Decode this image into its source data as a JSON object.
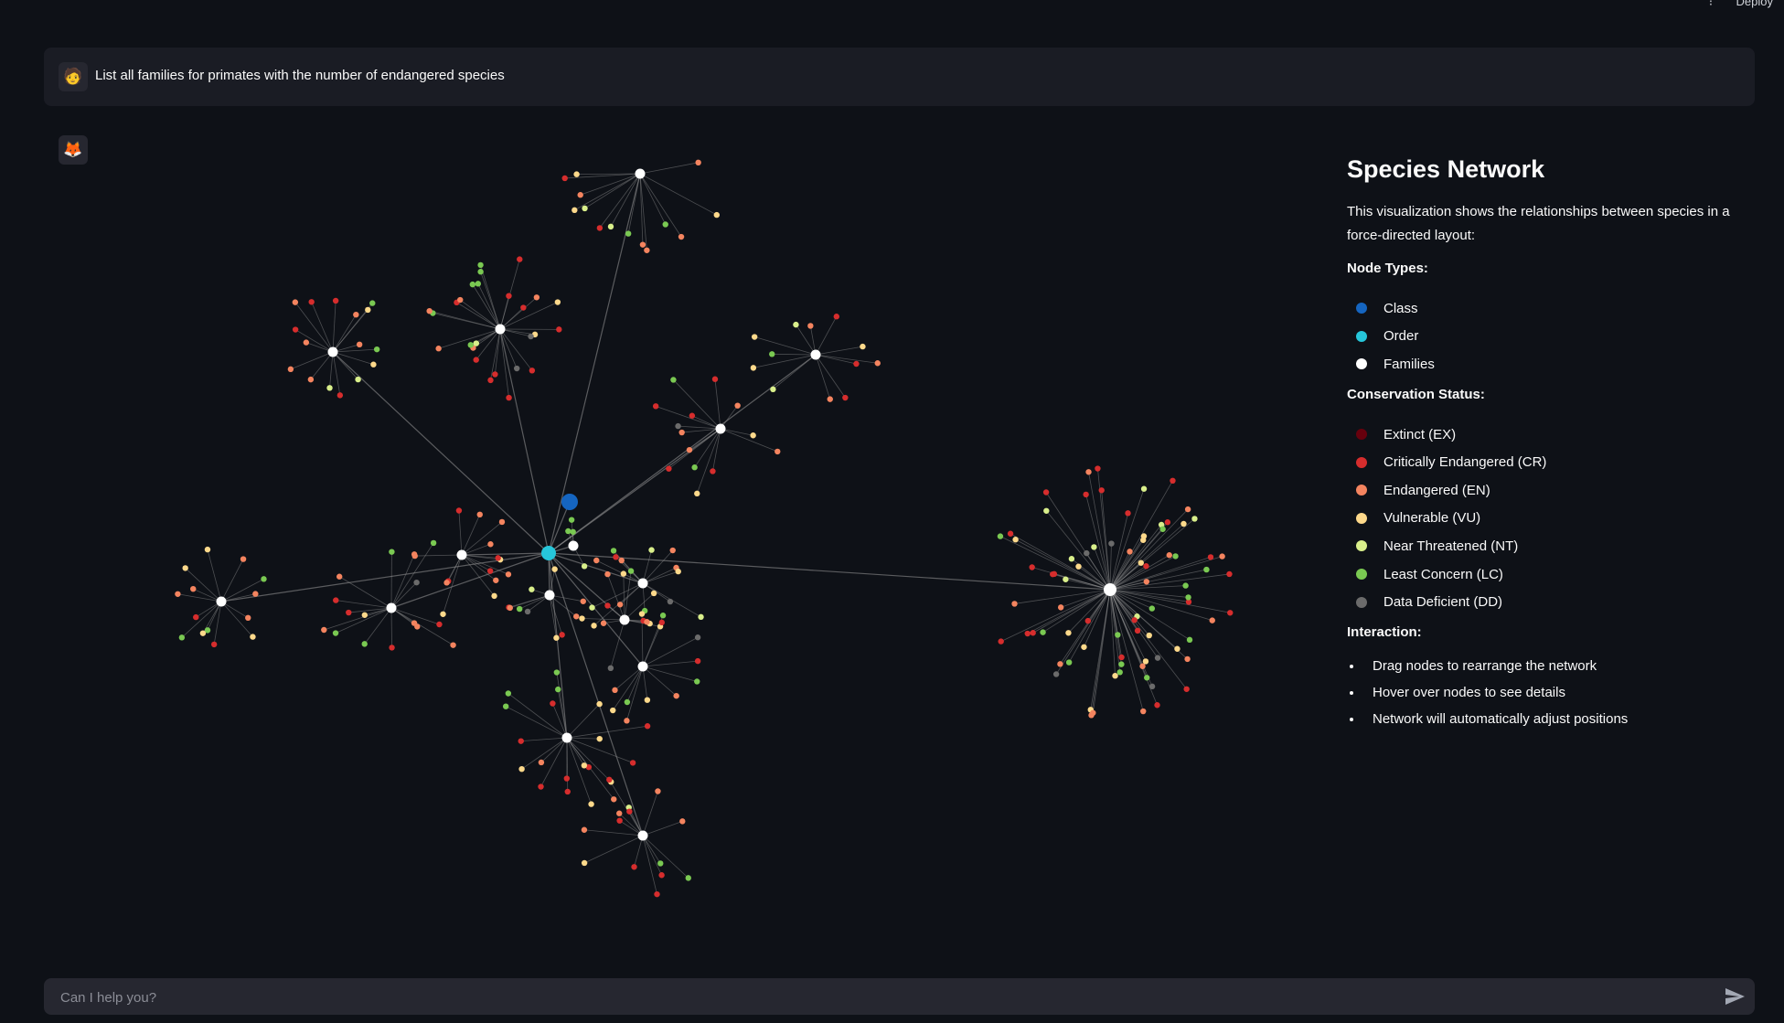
{
  "header": {
    "deploy_label": "Deploy",
    "menu_icon": "menu-icon"
  },
  "user_message": {
    "avatar": "🧑",
    "text": "List all families for primates with the number of endangered species"
  },
  "assistant": {
    "avatar": "🦊"
  },
  "legend": {
    "title": "Species Network",
    "description": "This visualization shows the relationships between species in a force-directed layout:",
    "node_types_heading": "Node Types:",
    "node_types": [
      {
        "label": "Class",
        "color": "#1565c0"
      },
      {
        "label": "Order",
        "color": "#26c6da"
      },
      {
        "label": "Families",
        "color": "#ffffff"
      }
    ],
    "status_heading": "Conservation Status:",
    "statuses": [
      {
        "label": "Extinct (EX)",
        "color": "#67000d"
      },
      {
        "label": "Critically Endangered (CR)",
        "color": "#d62d2d"
      },
      {
        "label": "Endangered (EN)",
        "color": "#f4845f"
      },
      {
        "label": "Vulnerable (VU)",
        "color": "#fdd98b"
      },
      {
        "label": "Near Threatened (NT)",
        "color": "#d9ef8b"
      },
      {
        "label": "Least Concern (LC)",
        "color": "#7ac952"
      },
      {
        "label": "Data Deficient (DD)",
        "color": "#6b6b6b"
      }
    ],
    "interaction_heading": "Interaction:",
    "interactions": [
      "Drag nodes to rearrange the network",
      "Hover over nodes to see details",
      "Network will automatically adjust positions"
    ]
  },
  "chat_input": {
    "placeholder": "Can I help you?",
    "send_icon": "send-icon"
  }
}
